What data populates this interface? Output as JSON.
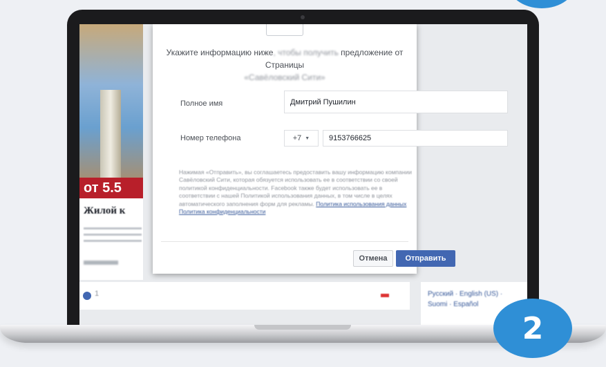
{
  "step_number": "2",
  "background": {
    "ad_price": "от 5.5",
    "ad_title": "Жилой к",
    "reaction_count": "1",
    "language_links": "Русский · English (US) · Suomi · Español"
  },
  "dialog": {
    "heading_start": "Укажите информацию ниже",
    "heading_blurred": ", чтобы получить",
    "heading_end": " предложение от Страницы",
    "page_name": "«Савёловский Сити»",
    "full_name_label": "Полное имя",
    "full_name_value": "Дмитрий Пушилин",
    "phone_label": "Номер телефона",
    "country_code": "+7",
    "phone_value": "9153766625",
    "consent_text": "Нажимая «Отправить», вы соглашаетесь предоставить вашу информацию компании Савёловский Сити, которая обязуется использовать ее в соответствии со своей политикой конфиденциальности. Facebook также будет использовать ее в соответствии с нашей Политикой использования данных, в том числе в целях автоматического заполнения форм для рекламы.",
    "data_policy_link": "Политика использования данных",
    "privacy_link": "Политика конфиденциальности",
    "cancel_label": "Отмена",
    "submit_label": "Отправить"
  },
  "colors": {
    "accent": "#4267b2",
    "badge": "#2f8fd6",
    "ad_banner": "#b81f2a"
  }
}
